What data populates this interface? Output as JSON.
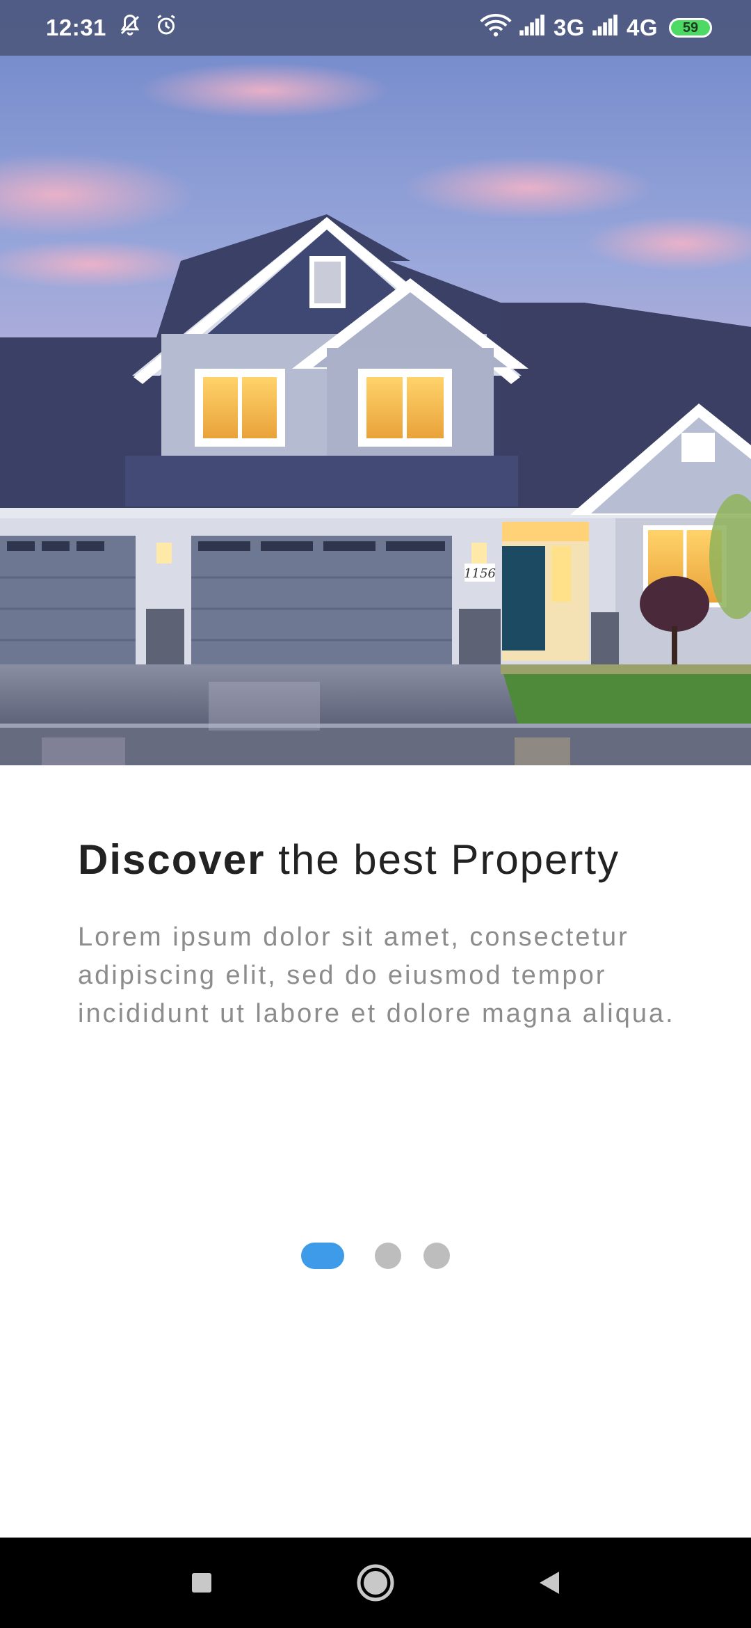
{
  "status_bar": {
    "time": "12:31",
    "network_3g": "3G",
    "network_4g": "4G",
    "battery_level": "59",
    "icons": [
      "mute-icon",
      "alarm-icon",
      "wifi-icon",
      "signal-icon",
      "signal-icon",
      "battery-icon"
    ]
  },
  "hero": {
    "house_number": "1156"
  },
  "onboarding": {
    "title_bold": "Discover",
    "title_rest": "the best Property",
    "description": "Lorem ipsum dolor sit amet, consectetur adipiscing elit, sed do eiusmod tempor incididunt ut labore et dolore magna aliqua.",
    "pages_total": 3,
    "current_page": 1
  },
  "colors": {
    "accent": "#3d9be9",
    "dot_inactive": "#bdbdbd",
    "title": "#222222",
    "body_text": "#8c8c8c",
    "nav_bar": "#000000"
  },
  "nav_bar": {
    "icons": [
      "recents-square-icon",
      "home-circle-icon",
      "back-triangle-icon"
    ]
  }
}
